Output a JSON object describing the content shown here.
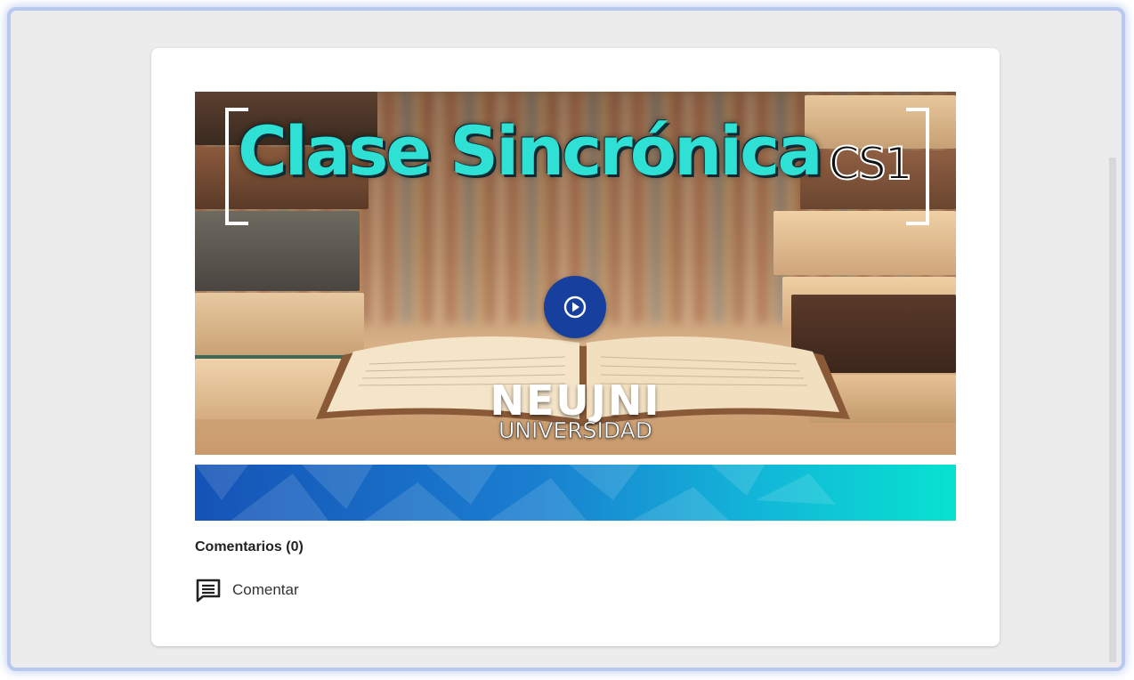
{
  "video": {
    "title": "Clase Sincrónica",
    "code": "CS1",
    "brand_name": "NEUJNI",
    "brand_subtitle": "UNIVERSIDAD",
    "play_icon": "play-circle-icon"
  },
  "comments": {
    "heading": "Comentarios (0)",
    "action_label": "Comentar",
    "action_icon": "comment-icon"
  },
  "colors": {
    "title_accent": "#2fe0d4",
    "play_button": "#173f9d",
    "banner_start": "#1553b6",
    "banner_end": "#07e2d0"
  }
}
